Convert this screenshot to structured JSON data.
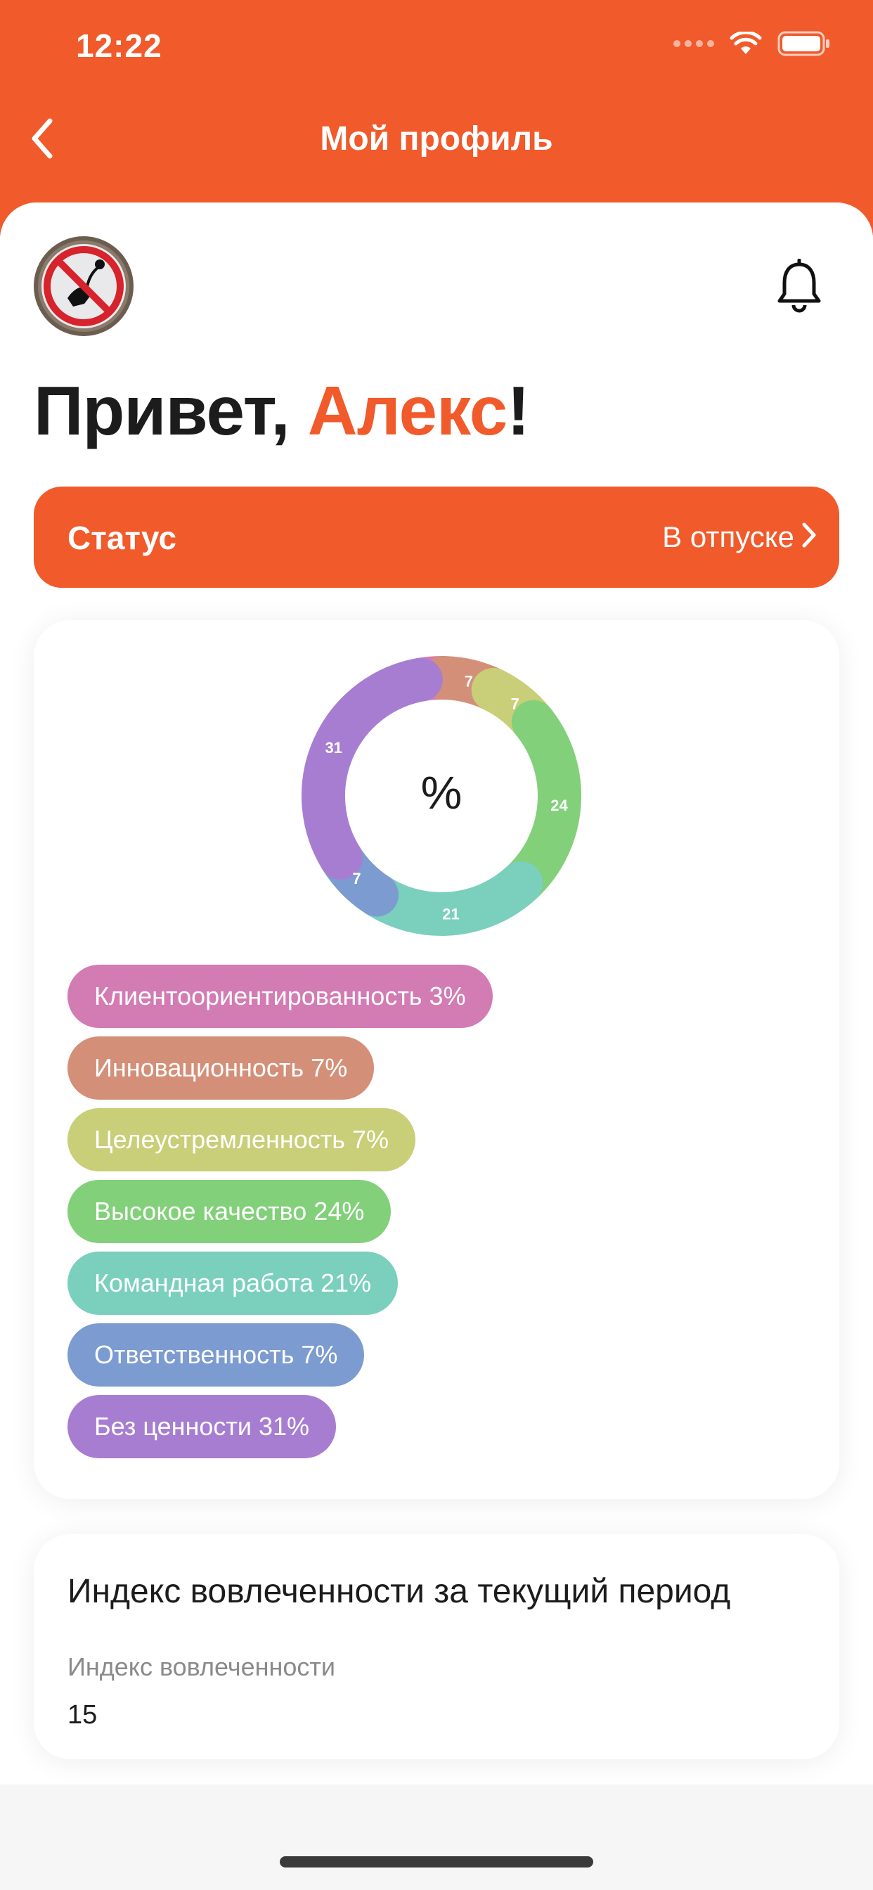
{
  "status_bar": {
    "time": "12:22"
  },
  "nav": {
    "title": "Мой профиль"
  },
  "profile": {
    "greeting_prefix": "Привет, ",
    "name": "Алекс",
    "greeting_suffix": "!"
  },
  "status_card": {
    "label": "Статус",
    "value": "В отпуске"
  },
  "chart_data": {
    "type": "pie",
    "center_label": "%",
    "slices": [
      {
        "name": "Клиентоориентированность",
        "value": 3,
        "label": "",
        "color": "#D37BB3"
      },
      {
        "name": "Инновационность",
        "value": 7,
        "label": "7",
        "color": "#D48F79"
      },
      {
        "name": "Целеустремленность",
        "value": 7,
        "label": "7",
        "color": "#C9CE78"
      },
      {
        "name": "Высокое качество",
        "value": 24,
        "label": "24",
        "color": "#82D07A"
      },
      {
        "name": "Командная работа",
        "value": 21,
        "label": "21",
        "color": "#7ACFBD"
      },
      {
        "name": "Ответственность",
        "value": 7,
        "label": "7",
        "color": "#7C9BD0"
      },
      {
        "name": "Без ценности",
        "value": 31,
        "label": "31",
        "color": "#A77DD2"
      }
    ]
  },
  "legend": [
    {
      "text": "Клиентоориентированность 3%",
      "color": "#D37BB3"
    },
    {
      "text": "Инновационность 7%",
      "color": "#D48F79"
    },
    {
      "text": "Целеустремленность 7%",
      "color": "#C9CE78"
    },
    {
      "text": "Высокое качество 24%",
      "color": "#82D07A"
    },
    {
      "text": "Командная работа 21%",
      "color": "#7ACFBD"
    },
    {
      "text": "Ответственность 7%",
      "color": "#7C9BD0"
    },
    {
      "text": "Без ценности 31%",
      "color": "#A77DD2"
    }
  ],
  "engagement": {
    "title": "Индекс вовлеченности за текущий период",
    "label": "Индекс вовлеченности",
    "value": "15"
  },
  "colors": {
    "accent": "#F15A2B"
  },
  "icons": {
    "back": "chevron-left-icon",
    "bell": "bell-icon",
    "chevron": "chevron-right-icon",
    "wifi": "wifi-icon",
    "battery": "battery-icon"
  }
}
